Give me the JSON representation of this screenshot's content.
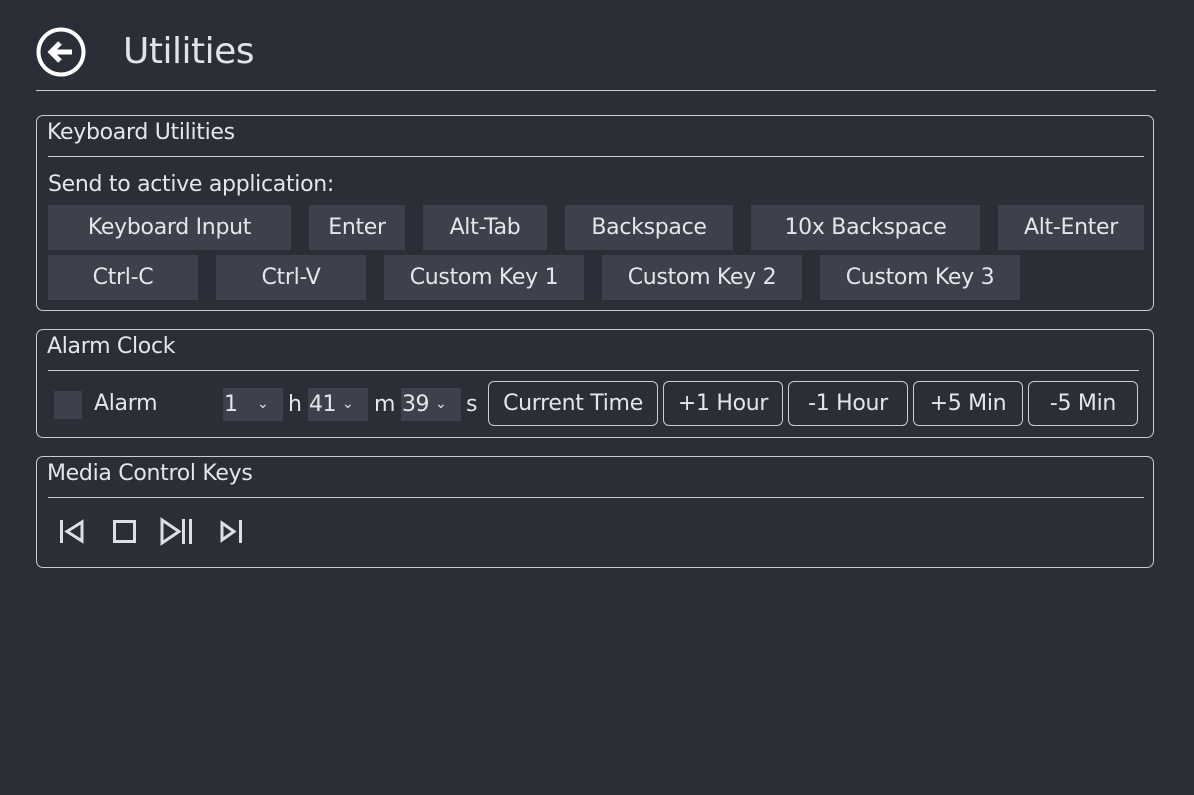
{
  "header": {
    "title": "Utilities",
    "back_icon": "back-arrow-circle-icon"
  },
  "keyboard": {
    "title": "Keyboard Utilities",
    "send_label": "Send to active application:",
    "row1": [
      "Keyboard Input",
      "Enter",
      "Alt-Tab",
      "Backspace",
      "10x Backspace",
      "Alt-Enter"
    ],
    "row2": [
      "Ctrl-C",
      "Ctrl-V",
      "Custom Key 1",
      "Custom Key 2",
      "Custom Key 3"
    ]
  },
  "alarm": {
    "title": "Alarm Clock",
    "checkbox_label": "Alarm",
    "checked": false,
    "hours": "1",
    "hours_unit": "h",
    "minutes": "41",
    "minutes_unit": "m",
    "seconds": "39",
    "seconds_unit": "s",
    "buttons": [
      "Current Time",
      "+1 Hour",
      "-1 Hour",
      "+5 Min",
      "-5 Min"
    ]
  },
  "media": {
    "title": "Media Control Keys",
    "icons": [
      "previous-track-icon",
      "stop-icon",
      "play-pause-icon",
      "next-track-icon"
    ]
  },
  "colors": {
    "background": "#2a2e36",
    "button_bg": "#3c414b",
    "border": "#c9ccd1",
    "text": "#e3e6ea"
  }
}
